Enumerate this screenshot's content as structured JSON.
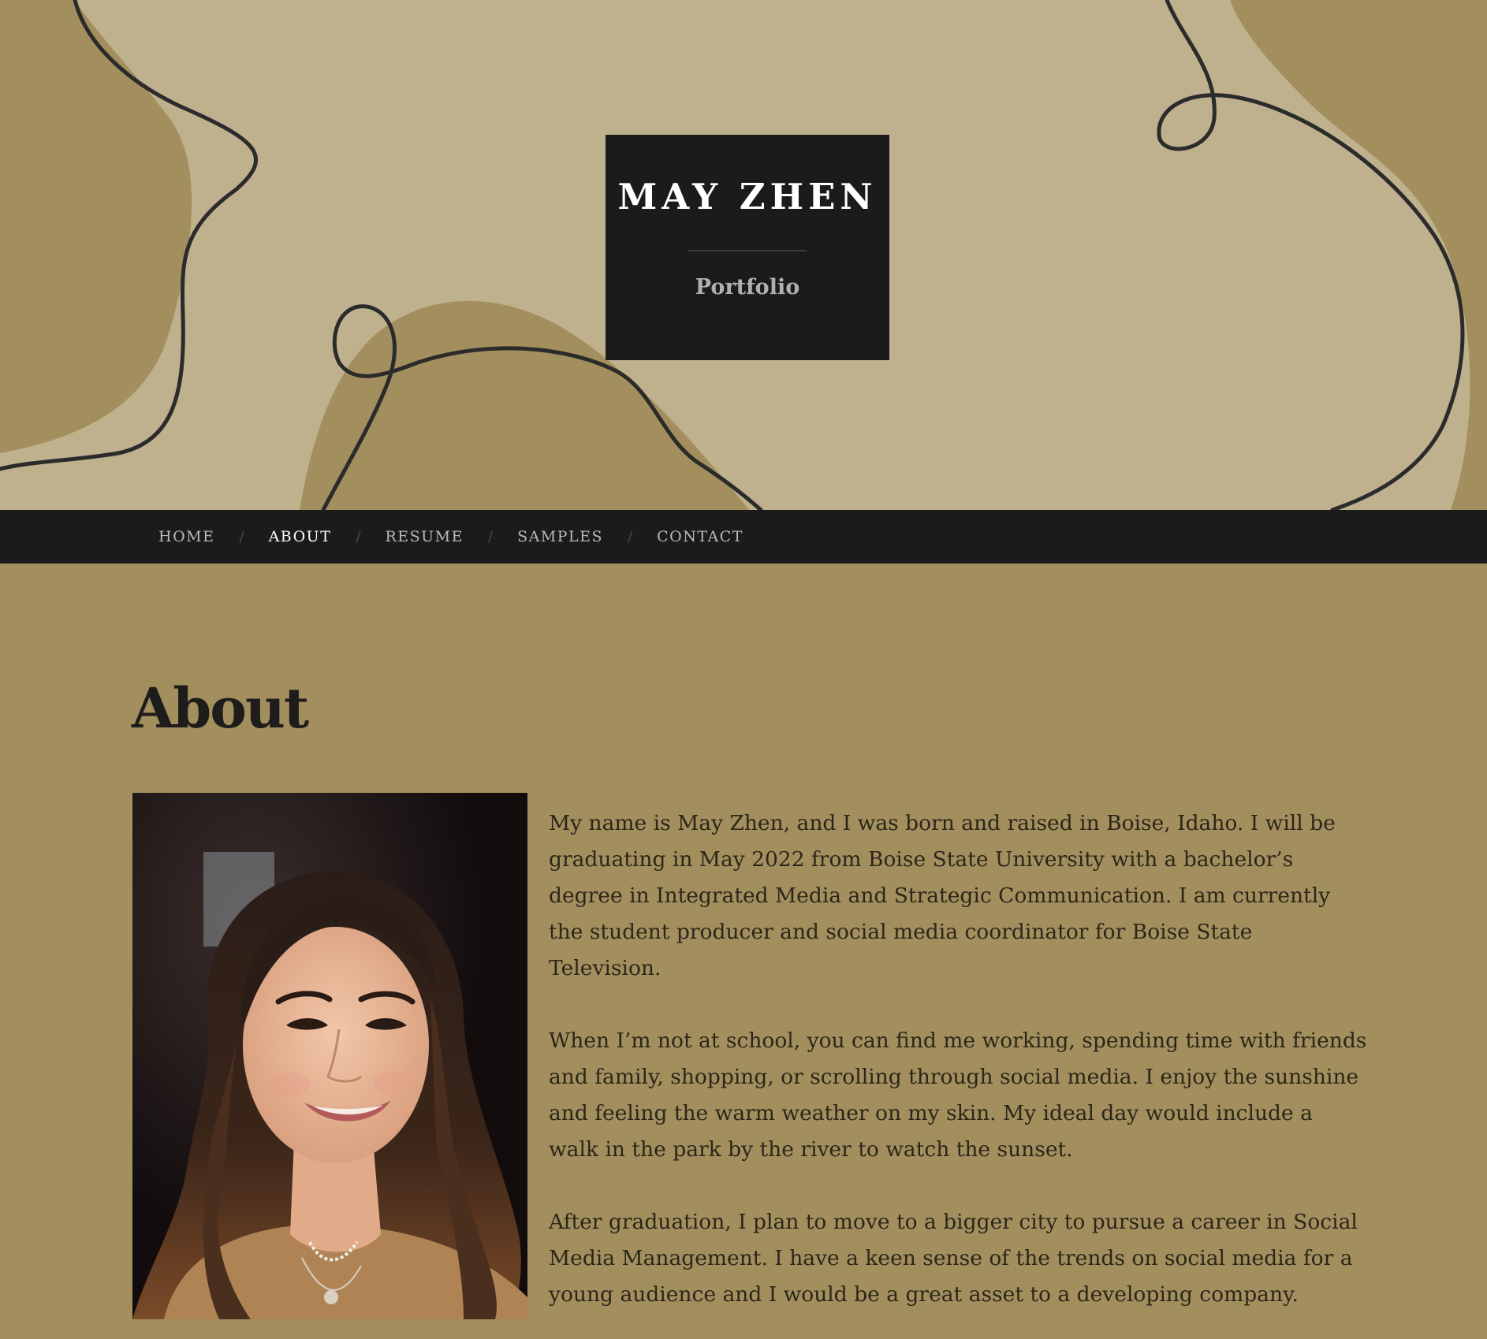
{
  "site": {
    "title": "MAY ZHEN",
    "subtitle": "Portfolio"
  },
  "nav": {
    "items": [
      {
        "label": "HOME",
        "active": false
      },
      {
        "label": "ABOUT",
        "active": true
      },
      {
        "label": "RESUME",
        "active": false
      },
      {
        "label": "SAMPLES",
        "active": false
      },
      {
        "label": "CONTACT",
        "active": false
      }
    ],
    "separator": "/"
  },
  "page": {
    "heading": "About",
    "photo_alt": "Portrait photo of May Zhen",
    "paragraphs": [
      "My name is May Zhen, and I was born and raised in Boise, Idaho. I will be graduating in May 2022 from Boise State University with a bachelor’s degree in Integrated Media and Strategic Communication. I am currently the student producer and social media coordinator for Boise State Television.",
      "When I’m not at school, you can find me working, spending time with friends and family, shopping, or scrolling through social media. I enjoy the sunshine and feeling the warm weather on my skin. My ideal day would include a walk in the park by the river to watch the sunset.",
      "After graduation, I plan to move to a bigger city to pursue a career in Social Media Management. I have a keen sense of the trends on social media for a young audience and I would be a great asset to a developing company."
    ]
  },
  "colors": {
    "header_light": "#bfb18d",
    "header_dark_blob": "#a38f5e",
    "page_background": "#a38f5e",
    "nav_background": "#1b1b1b",
    "title_box": "#1b1b1b",
    "squiggle_line": "#2b2b2b"
  }
}
